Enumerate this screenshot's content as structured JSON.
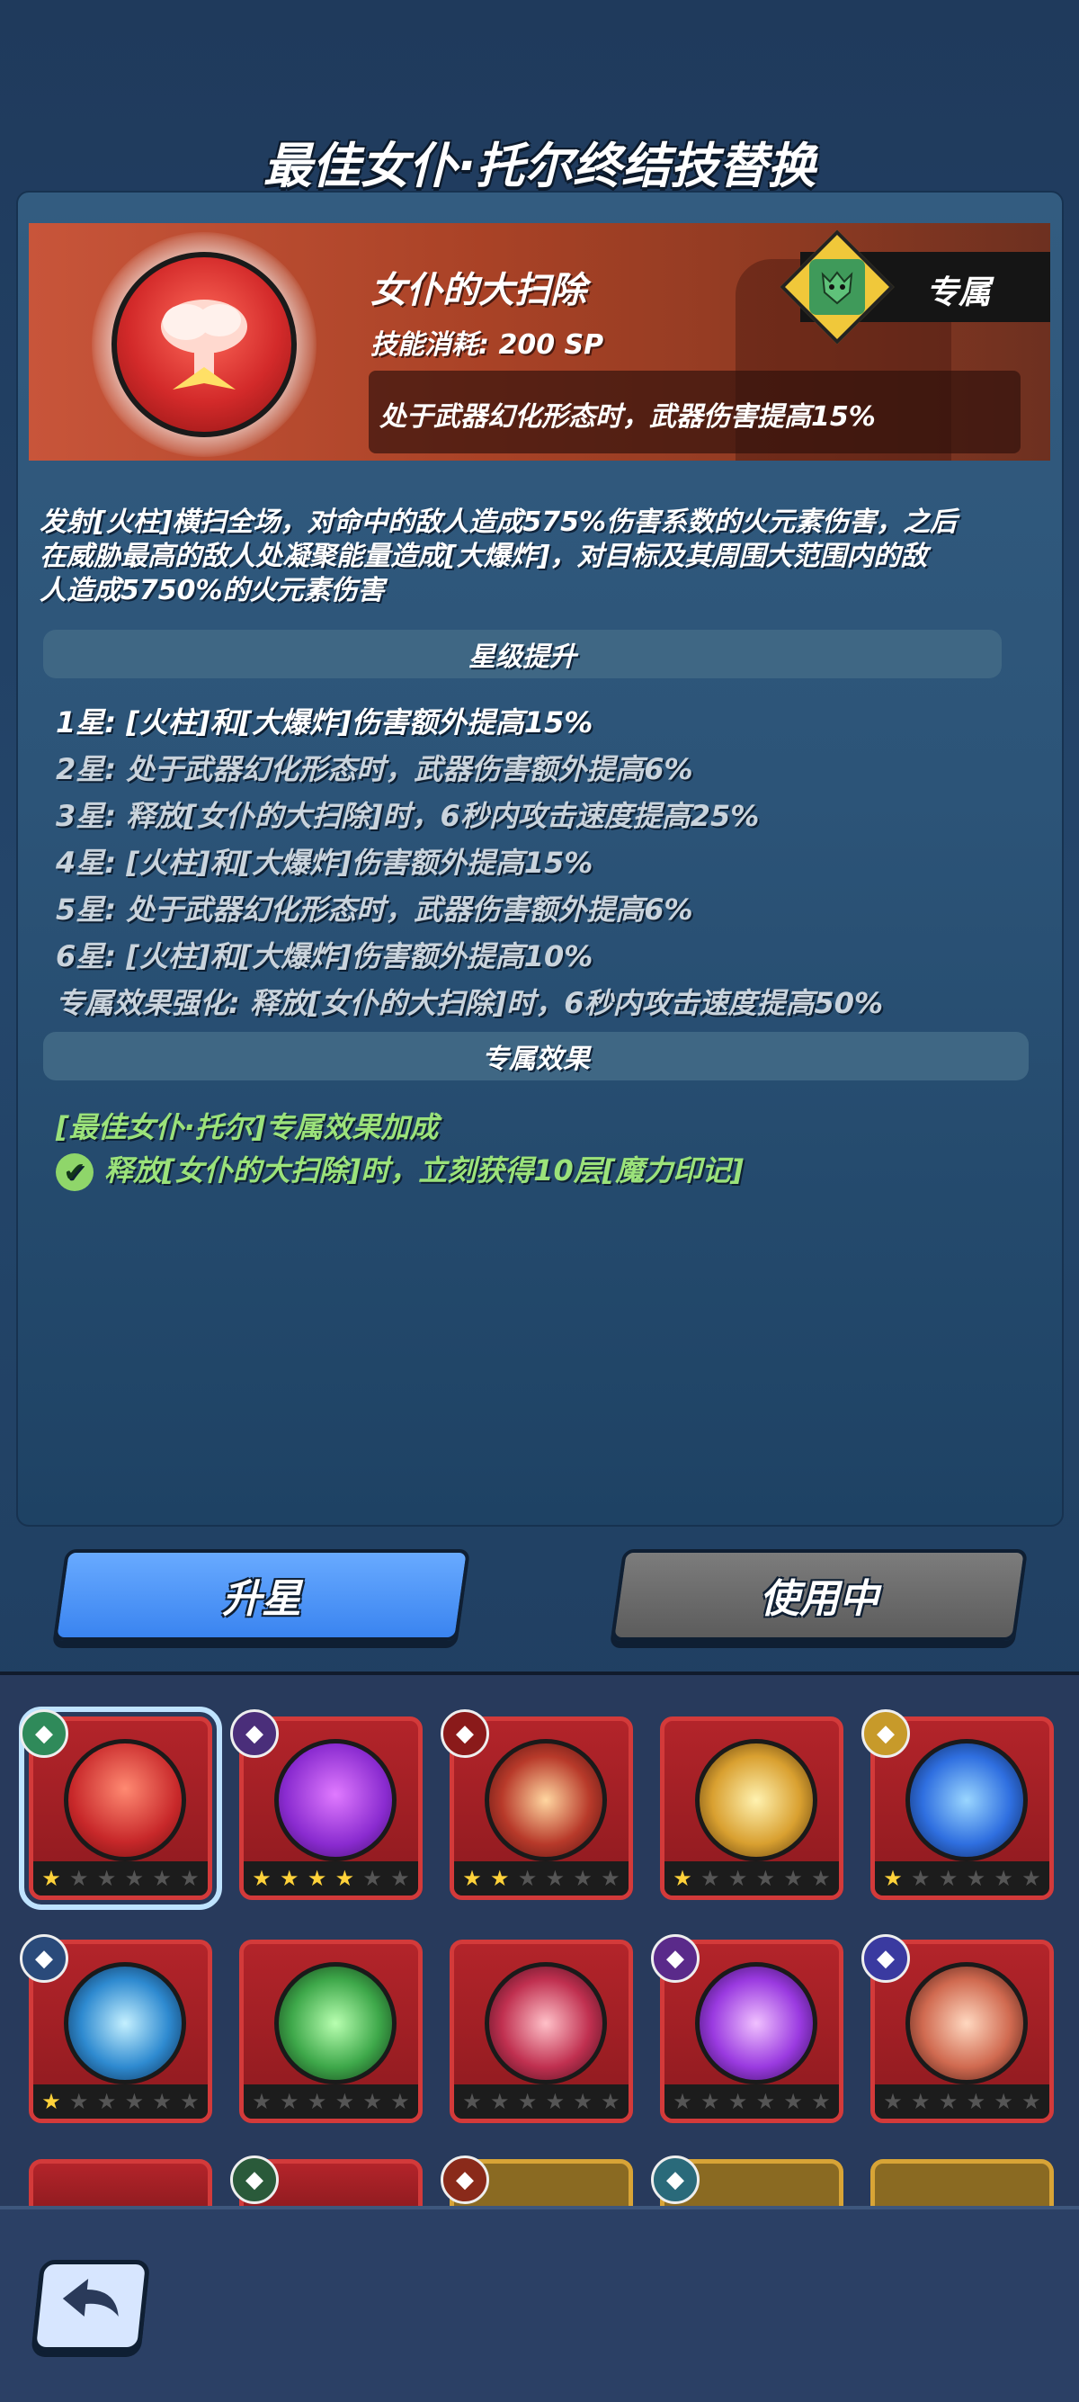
{
  "title": "最佳女仆·托尔终结技替换",
  "skill": {
    "name": "女仆的大扫除",
    "cost": "技能消耗: 200 SP",
    "exclusive_label": "专属",
    "weapon_bonus": "处于武器幻化形态时，武器伤害提高15%"
  },
  "description": [
    "发射[火柱]横扫全场，对命中的敌人造成575%伤害系数的火元素伤害，之后",
    "在威胁最高的敌人处凝聚能量造成[大爆炸]，对目标及其周围大范围内的敌",
    "人造成5750%的火元素伤害"
  ],
  "star_section": {
    "header": "星级提升",
    "lines": [
      "1星: [火柱]和[大爆炸]伤害额外提高15%",
      "2星: 处于武器幻化形态时，武器伤害额外提高6%",
      "3星: 释放[女仆的大扫除]时，6秒内攻击速度提高25%",
      "4星: [火柱]和[大爆炸]伤害额外提高15%",
      "5星: 处于武器幻化形态时，武器伤害额外提高6%",
      "6星: [火柱]和[大爆炸]伤害额外提高10%",
      "专属效果强化: 释放[女仆的大扫除]时，6秒内攻击速度提高50%"
    ]
  },
  "exclusive_section": {
    "header": "专属效果",
    "bonus_title": "[最佳女仆·托尔]专属效果加成",
    "bonus_effect": "释放[女仆的大扫除]时，立刻获得10层[魔力印记]"
  },
  "buttons": {
    "upgrade": "升星",
    "in_use": "使用中"
  },
  "colors": {
    "upgrade_button": "#4a90f5",
    "in_use_button": "#6b6b6b",
    "card_border": "#d33a3a",
    "green_text": "#9be27a",
    "star_on": "#ffd23a"
  },
  "skill_cards": [
    {
      "icon": "explosion-icon",
      "stars": 1,
      "selected": true
    },
    {
      "icon": "cauldron-icon",
      "stars": 4,
      "selected": false
    },
    {
      "icon": "fire-pillar-icon",
      "stars": 2,
      "selected": false
    },
    {
      "icon": "lightning-icon",
      "stars": 1,
      "selected": false
    },
    {
      "icon": "blue-beast-icon",
      "stars": 1,
      "selected": false
    },
    {
      "icon": "yin-yang-icon",
      "stars": 1,
      "selected": false
    },
    {
      "icon": "green-cloak-icon",
      "stars": 0,
      "selected": false
    },
    {
      "icon": "flower-icon",
      "stars": 0,
      "selected": false
    },
    {
      "icon": "purple-orbit-icon",
      "stars": 0,
      "selected": false
    },
    {
      "icon": "planet-icon",
      "stars": 0,
      "selected": false
    }
  ]
}
